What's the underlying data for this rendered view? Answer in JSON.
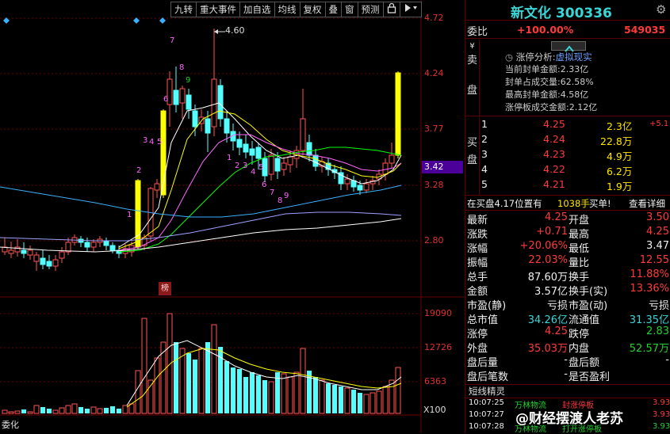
{
  "toolbar": {
    "items": [
      "九转",
      "重大事件",
      "加自选",
      "均线",
      "复权",
      "叠",
      "窗",
      "预测"
    ],
    "lock_icon": "lock-icon",
    "play_icon": "play-icon"
  },
  "chart": {
    "price_ticks": [
      "4.72",
      "4.24",
      "3.77",
      "3.28",
      "2.80"
    ],
    "current_price_tag": "3.42",
    "peak_label": "4.60",
    "bang_tag": "榜",
    "volume_ticks": [
      "19090",
      "12726",
      "6363"
    ],
    "volume_unit": "X100",
    "bottom_label": "委化",
    "nine_turn_up": [
      "1",
      "2",
      "3",
      "4",
      "5",
      "6",
      "7",
      "8",
      "9"
    ],
    "nine_turn_down": [
      "1",
      "2",
      "3",
      "4",
      "5",
      "6",
      "7",
      "8",
      "9"
    ]
  },
  "colors": {
    "up_candle": "#ff5555",
    "down_candle": "#54ffff",
    "limit_up": "#ffff00",
    "ma5": "#ffffff",
    "ma10": "#ffff00",
    "ma20": "#ff66ff",
    "ma30": "#00ff00",
    "ma60": "#3ab0ff",
    "ma120": "#ffffff",
    "grid": "#6a0000"
  },
  "panel": {
    "title": "新文化 300336",
    "weibi": {
      "label": "委比",
      "value": "+100.00%",
      "right": "549035"
    },
    "sell_label": [
      "卖",
      "盘"
    ],
    "sell_symbol": "¥",
    "limit_info": {
      "head_prefix": "涨停分析:",
      "head_value": "虚拟现实",
      "lines": [
        [
          "当前封单金额:",
          "2.33亿"
        ],
        [
          "封单占成交量:",
          "62.58%"
        ],
        [
          "最高封单金额:",
          "4.58亿"
        ],
        [
          "涨停板成交金额:",
          "2.12亿"
        ]
      ]
    },
    "buy_label": [
      "买",
      "盘"
    ],
    "buy_rows": [
      {
        "idx": "1",
        "price": "4.25",
        "vol": "2.3亿",
        "chg": "+5.1"
      },
      {
        "idx": "2",
        "price": "4.24",
        "vol": "22.8万",
        "chg": ""
      },
      {
        "idx": "3",
        "price": "4.23",
        "vol": "4.9万",
        "chg": ""
      },
      {
        "idx": "4",
        "price": "4.22",
        "vol": "6.2万",
        "chg": ""
      },
      {
        "idx": "5",
        "price": "4.21",
        "vol": "1.9万",
        "chg": ""
      }
    ],
    "queue": {
      "text": "在买盘4.17位置有",
      "count": "1038手",
      "action": "买单!",
      "detail": "查看详细"
    },
    "stats": [
      [
        "最新",
        "4.25",
        "开盘",
        "3.50"
      ],
      [
        "涨跌",
        "+0.71",
        "最高",
        "4.25"
      ],
      [
        "涨幅",
        "+20.06%",
        "最低",
        "3.47"
      ],
      [
        "振幅",
        "22.03%",
        "量比",
        "12.55"
      ],
      [
        "总手",
        "87.60万",
        "换手",
        "11.88%"
      ],
      [
        "金额",
        "3.57亿",
        "换手(实)",
        "13.36%"
      ],
      [
        "市盈(静)",
        "亏损",
        "市盈(动)",
        "亏损"
      ],
      [
        "总市值",
        "34.26亿",
        "流通值",
        "31.35亿"
      ],
      [
        "涨停",
        "4.25",
        "跌停",
        "2.83"
      ],
      [
        "外盘",
        "35.03万",
        "内盘",
        "52.57万"
      ],
      [
        "盘后量",
        "-",
        "盘后额",
        "-"
      ],
      [
        "盘后笔数",
        "-",
        "是否盈利",
        ""
      ]
    ],
    "short_title": "短线精灵",
    "news": [
      {
        "time": "10:07:25",
        "name": "万林物流",
        "event": "封涨停板",
        "price": "3.93"
      },
      {
        "time": "10:07:27",
        "name": "",
        "event": "",
        "price": "3.93"
      },
      {
        "time": "10:07:28",
        "name": "万林物流",
        "event": "打开涨停板",
        "price": "3.93"
      }
    ],
    "watermark": "@财经摆渡人老苏"
  }
}
